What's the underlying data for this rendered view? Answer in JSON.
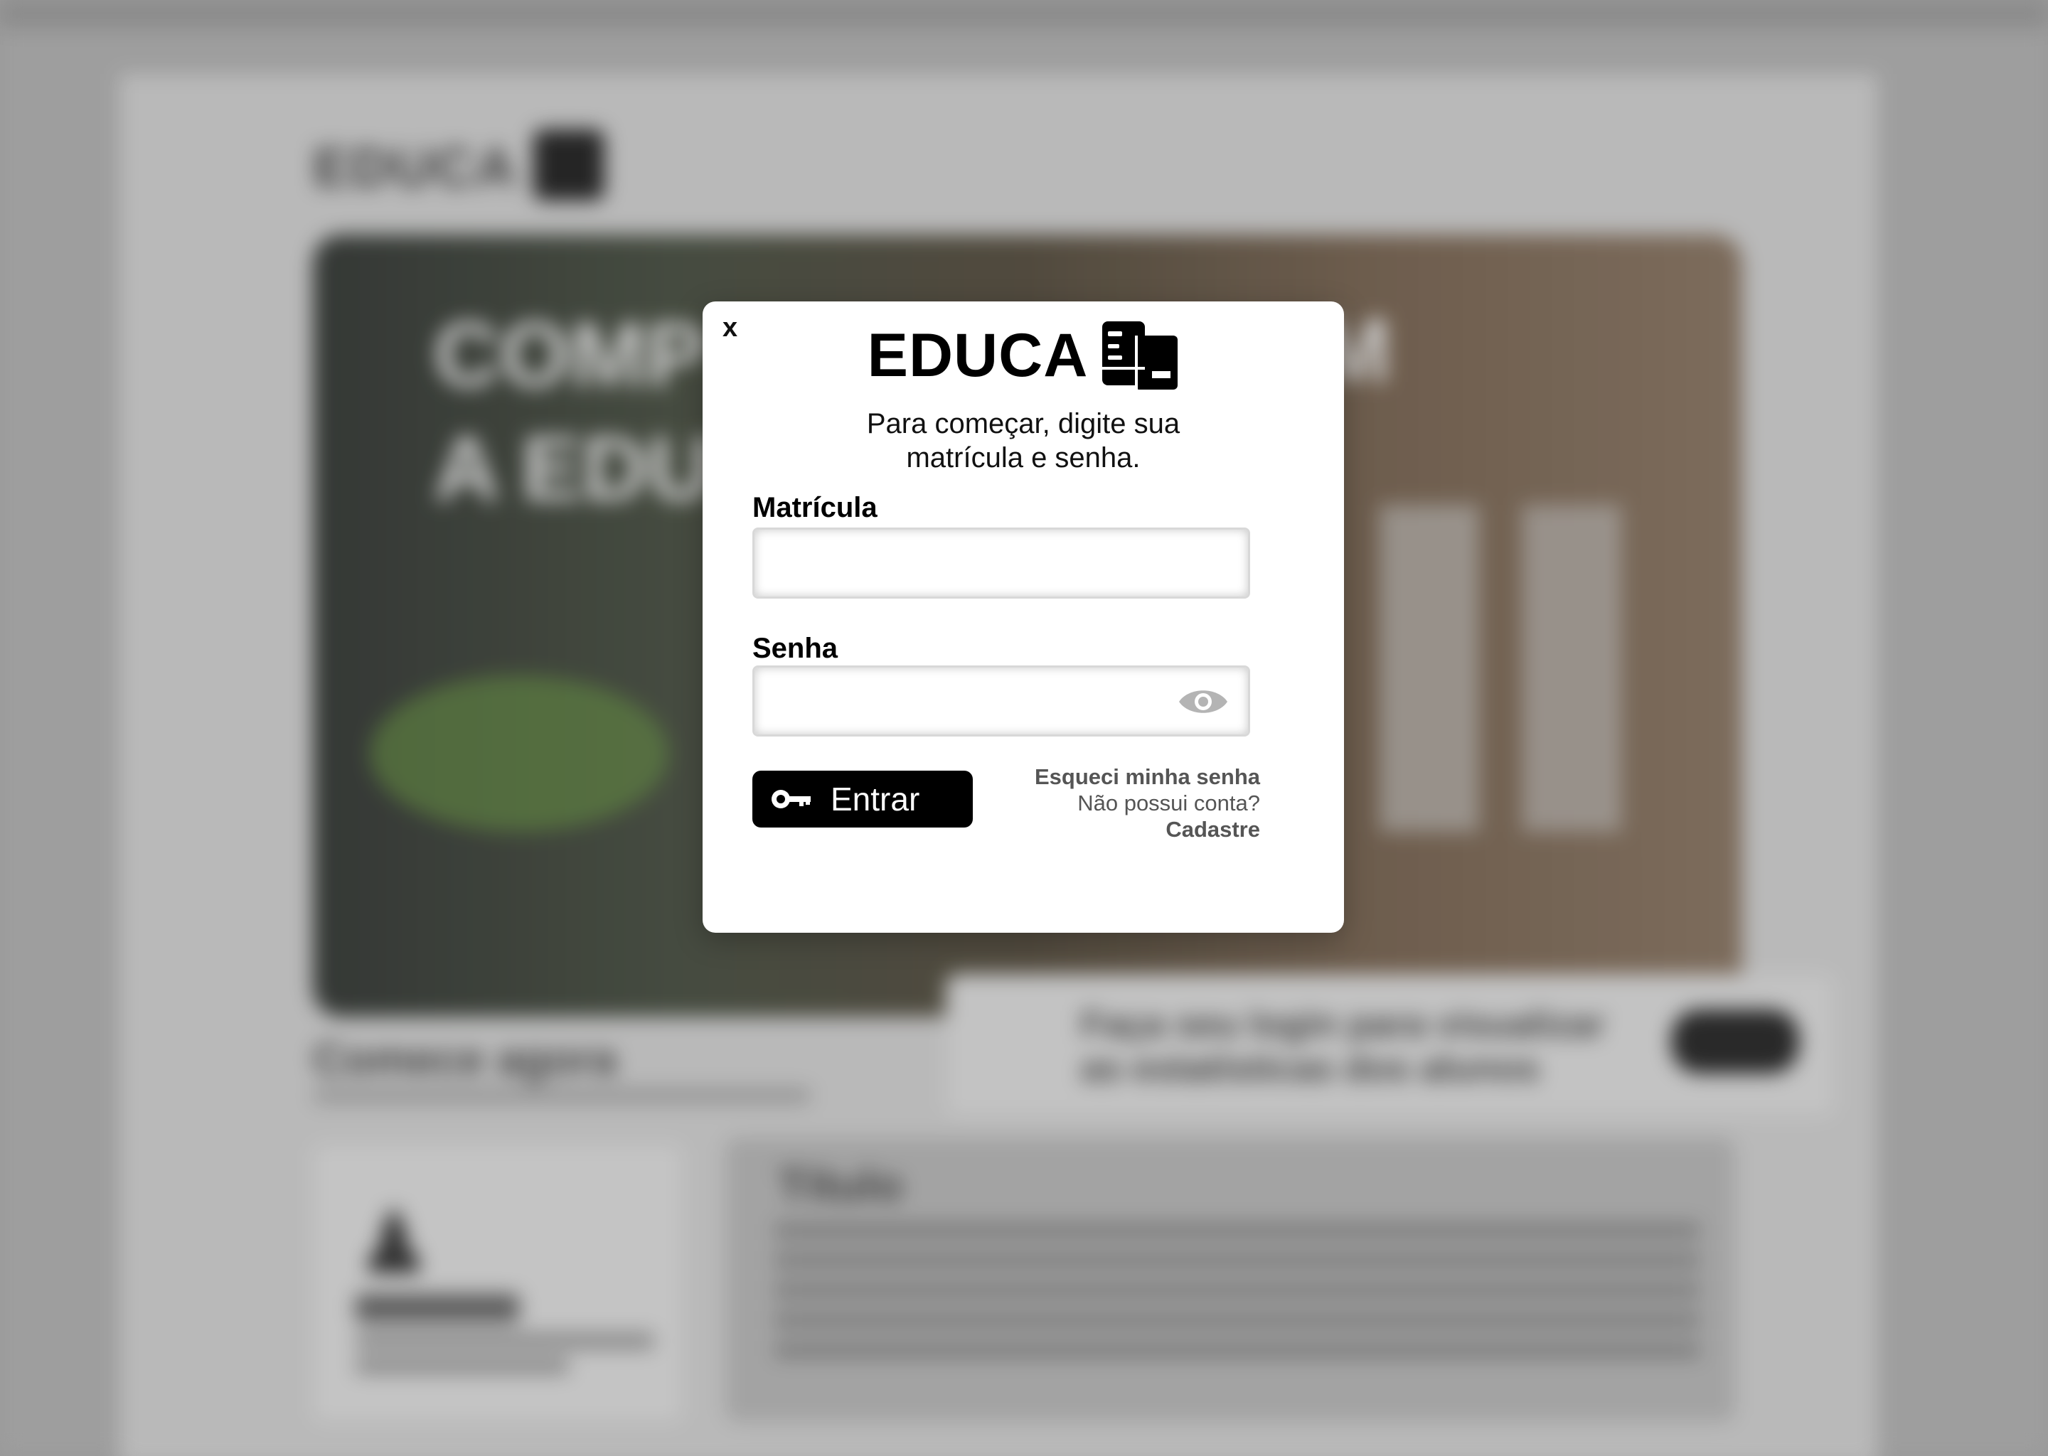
{
  "background": {
    "logo_text": "EDUCA",
    "hero_text_line1": "COMP",
    "hero_text_line2": "A EDU",
    "hero_text_right": "M",
    "start_heading": "Comece agora",
    "banner_text_line1": "Faça seu login para visualizar",
    "banner_text_line2": "as estatísticas dos alunos",
    "card_right_title": "Título"
  },
  "modal": {
    "close_label": "x",
    "brand_text": "EDUCA",
    "subtitle_line1": "Para começar, digite sua",
    "subtitle_line2": "matrícula e senha.",
    "matricula_label": "Matrícula",
    "matricula_value": "",
    "senha_label": "Senha",
    "senha_value": "",
    "enter_label": "Entrar",
    "forgot_label": "Esqueci minha senha",
    "no_account_label": "Não possui conta?",
    "signup_label": "Cadastre"
  },
  "colors": {
    "modal_bg": "#ffffff",
    "button_bg": "#000000",
    "link_text": "#555555",
    "overlay_bg": "#a3a3a3"
  },
  "icons": {
    "brand": "book-icon",
    "password_toggle": "eye-icon",
    "enter": "key-icon"
  }
}
